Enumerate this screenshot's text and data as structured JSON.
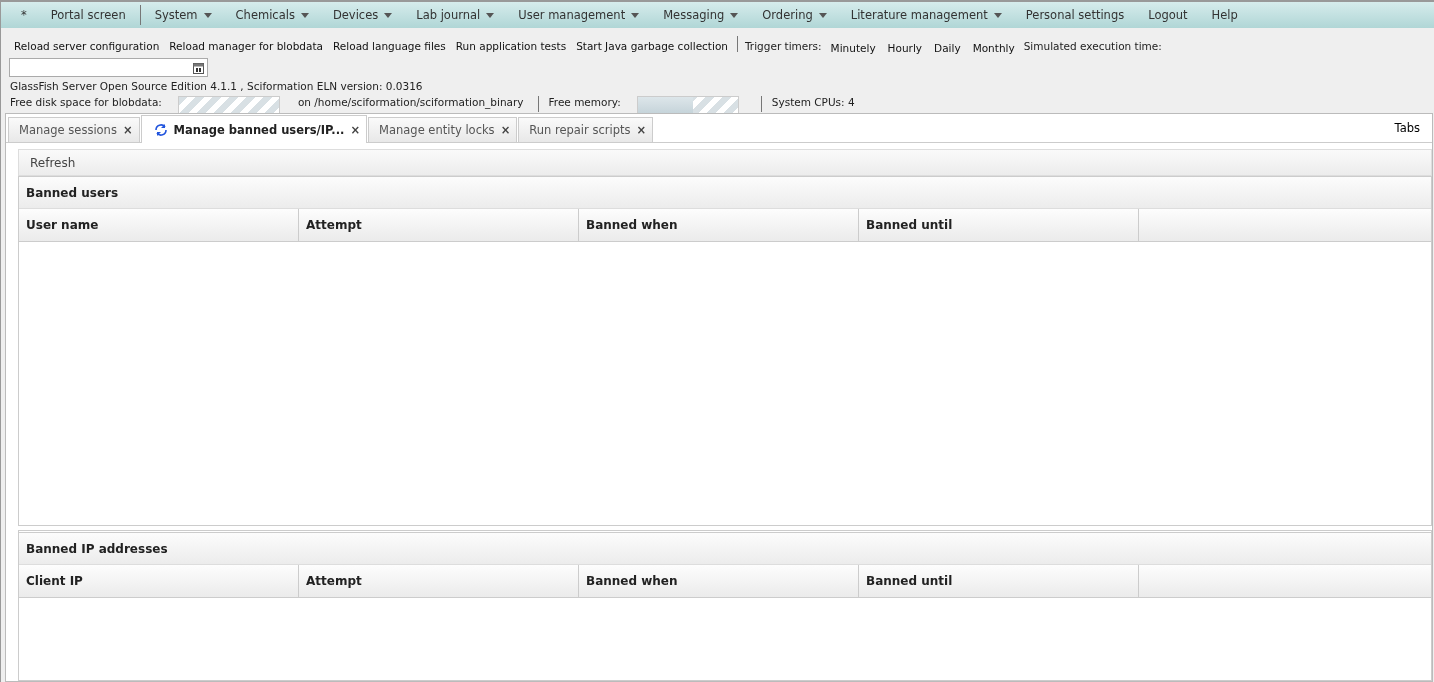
{
  "menu": [
    {
      "label": "*",
      "has_menu": false
    },
    {
      "label": "Portal screen",
      "has_menu": false
    },
    {
      "label": "System",
      "has_menu": true
    },
    {
      "label": "Chemicals",
      "has_menu": true
    },
    {
      "label": "Devices",
      "has_menu": true
    },
    {
      "label": "Lab journal",
      "has_menu": true
    },
    {
      "label": "User management",
      "has_menu": true
    },
    {
      "label": "Messaging",
      "has_menu": true
    },
    {
      "label": "Ordering",
      "has_menu": true
    },
    {
      "label": "Literature management",
      "has_menu": true
    },
    {
      "label": "Personal settings",
      "has_menu": false
    },
    {
      "label": "Logout",
      "has_menu": false
    },
    {
      "label": "Help",
      "has_menu": false
    }
  ],
  "actions": [
    "Reload server configuration",
    "Reload manager for blobdata",
    "Reload language files",
    "Run application tests",
    "Start Java garbage collection"
  ],
  "timers": {
    "label": "Trigger timers:",
    "buttons": [
      "Minutely",
      "Hourly",
      "Daily",
      "Monthly"
    ],
    "simulated_label": "Simulated execution time:"
  },
  "version": "GlassFish Server Open Source Edition 4.1.1 , Sciformation ELN version: 0.0316",
  "status": {
    "disk_label": "Free disk space for blobdata:",
    "disk_path": "on /home/sciformation/sciformation_binary",
    "memory_label": "Free memory:",
    "memory": {
      "level": 0.55
    },
    "cpus": "System CPUs: 4"
  },
  "tabs": [
    {
      "label": "Manage sessions",
      "selected": false,
      "loading": false,
      "close": "×"
    },
    {
      "label": "Manage banned users/IP...",
      "selected": true,
      "loading": true,
      "close": "×"
    },
    {
      "label": "Manage entity locks",
      "selected": false,
      "loading": false,
      "close": "×"
    },
    {
      "label": "Run repair scripts",
      "selected": false,
      "loading": false,
      "close": "×"
    }
  ],
  "tabs_menu": "Tabs",
  "refresh": "Refresh",
  "panels": [
    {
      "title": "Banned users",
      "columns": [
        "User name",
        "Attempt",
        "Banned when",
        "Banned until"
      ]
    },
    {
      "title": "Banned IP addresses",
      "columns": [
        "Client IP",
        "Attempt",
        "Banned when",
        "Banned until"
      ]
    }
  ]
}
